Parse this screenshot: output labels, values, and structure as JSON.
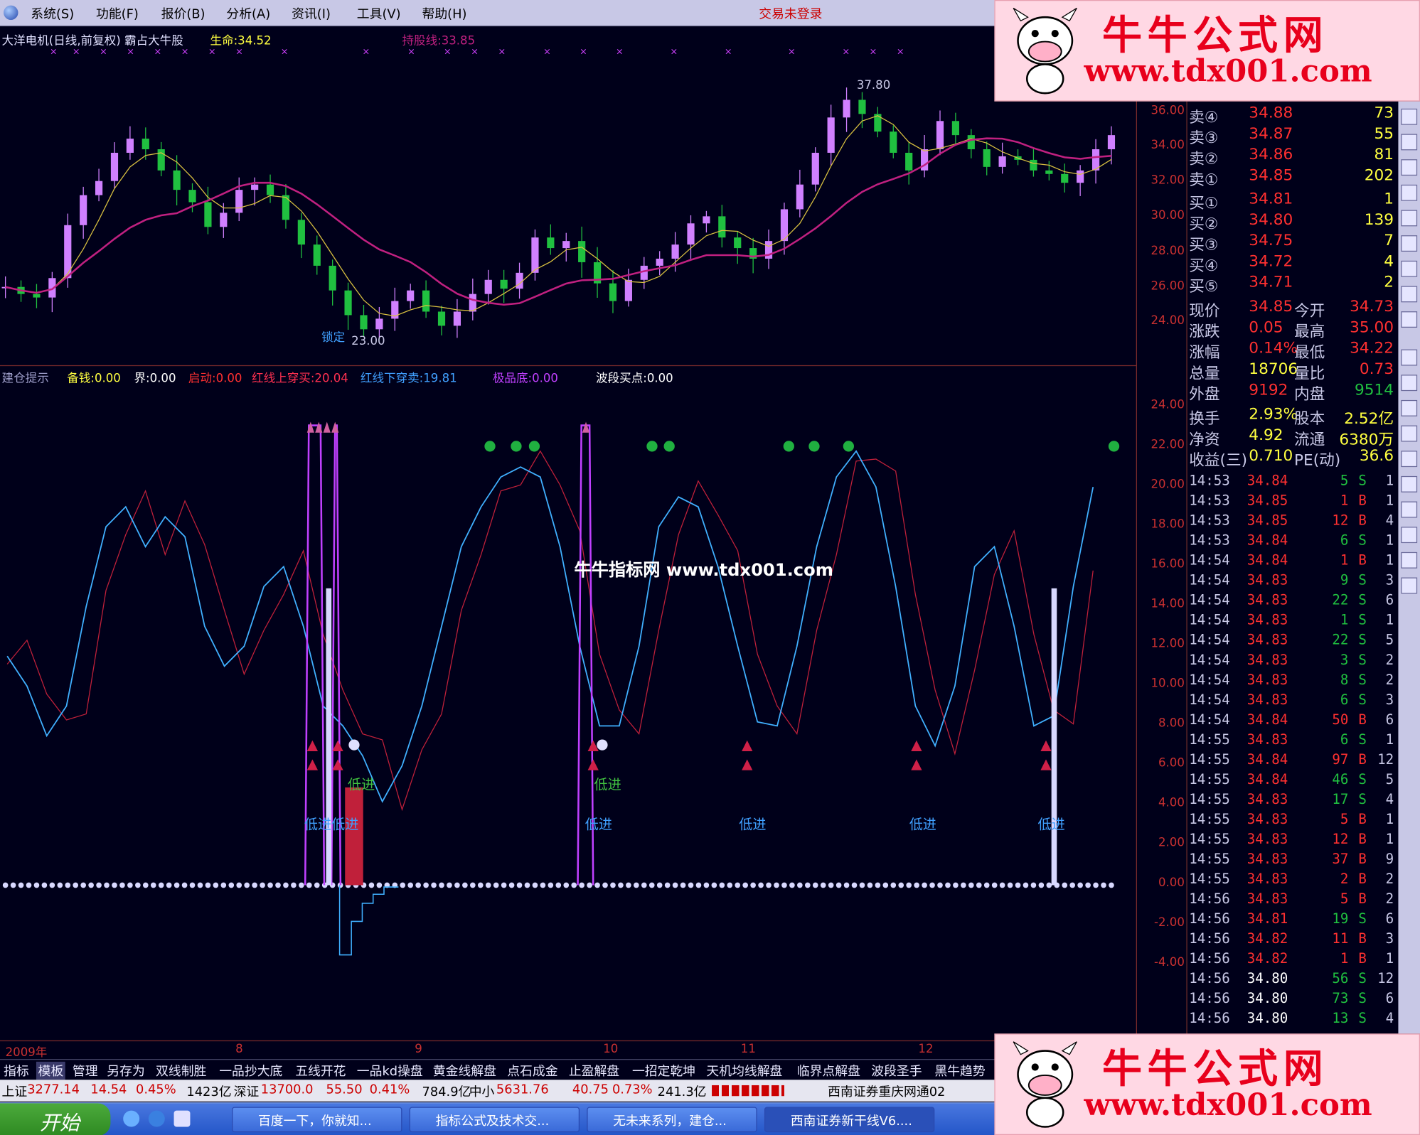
{
  "menu": {
    "items": [
      "系统(S)",
      "功能(F)",
      "报价(B)",
      "分析(A)",
      "资讯(I)",
      "工具(V)",
      "帮助(H)"
    ],
    "status": "交易未登录"
  },
  "ad": {
    "title": "牛牛公式网",
    "url": "www.tdx001.com"
  },
  "watermark": "牛牛指标网 www.tdx001.com",
  "main_chart": {
    "header": "大洋电机(日线,前复权) 霸占大牛股",
    "life_label": "生命:34.52",
    "hold_label": "持股线:33.85",
    "high_label": "37.80",
    "low_label": "23.00",
    "low_marker": "锁定"
  },
  "indicator": {
    "labels": [
      {
        "text": "建仓提示",
        "color": "#9c9cc8"
      },
      {
        "text": "备钱:0.00",
        "color": "#ffff40"
      },
      {
        "text": "界:0.00",
        "color": "#ffffff"
      },
      {
        "text": "启动:0.00",
        "color": "#ff3030"
      },
      {
        "text": "红线上穿买:20.04",
        "color": "#ff3050"
      },
      {
        "text": "红线下穿卖:19.81",
        "color": "#40a0ff"
      },
      {
        "text": "极品底:0.00",
        "color": "#c040ff"
      },
      {
        "text": "波段买点:0.00",
        "color": "#ffffff"
      }
    ],
    "signal_low": "低进",
    "signal_green": "低进"
  },
  "axes": {
    "price_ticks": [
      "36.00",
      "34.00",
      "32.00",
      "30.00",
      "28.00",
      "26.00",
      "24.00"
    ],
    "ind_ticks": [
      "24.00",
      "22.00",
      "20.00",
      "18.00",
      "16.00",
      "14.00",
      "12.00",
      "10.00",
      "8.00",
      "6.00",
      "4.00",
      "2.00",
      "0.00",
      "-2.00",
      "-4.00"
    ],
    "dates": [
      "2009年",
      "8",
      "9",
      "10",
      "11",
      "12"
    ]
  },
  "quotes": {
    "sell": [
      {
        "label": "卖④",
        "price": "34.88",
        "vol": "73"
      },
      {
        "label": "卖③",
        "price": "34.87",
        "vol": "55"
      },
      {
        "label": "卖②",
        "price": "34.86",
        "vol": "81"
      },
      {
        "label": "卖①",
        "price": "34.85",
        "vol": "202"
      }
    ],
    "buy": [
      {
        "label": "买①",
        "price": "34.81",
        "vol": "1"
      },
      {
        "label": "买②",
        "price": "34.80",
        "vol": "139"
      },
      {
        "label": "买③",
        "price": "34.75",
        "vol": "7"
      },
      {
        "label": "买④",
        "price": "34.72",
        "vol": "4"
      },
      {
        "label": "买⑤",
        "price": "34.71",
        "vol": "2"
      }
    ],
    "stats": [
      {
        "k1": "现价",
        "v1": "34.85",
        "k2": "今开",
        "v2": "34.73"
      },
      {
        "k1": "涨跌",
        "v1": "0.05",
        "k2": "最高",
        "v2": "35.00"
      },
      {
        "k1": "涨幅",
        "v1": "0.14%",
        "k2": "最低",
        "v2": "34.22"
      },
      {
        "k1": "总量",
        "v1": "18706",
        "k2": "量比",
        "v2": "0.73"
      },
      {
        "k1": "外盘",
        "v1": "9192",
        "k2": "内盘",
        "v2": "9514"
      }
    ],
    "stats2": [
      {
        "k1": "换手",
        "v1": "2.93%",
        "k2": "股本",
        "v2": "2.52亿"
      },
      {
        "k1": "净资",
        "v1": "4.92",
        "k2": "流通",
        "v2": "6380万"
      },
      {
        "k1": "收益(三)",
        "v1": "0.710",
        "k2": "PE(动)",
        "v2": "36.6"
      }
    ]
  },
  "ticks": [
    [
      "14:53",
      "34.84",
      "5",
      "S",
      "1"
    ],
    [
      "14:53",
      "34.85",
      "1",
      "B",
      "1"
    ],
    [
      "14:53",
      "34.85",
      "12",
      "B",
      "4"
    ],
    [
      "14:53",
      "34.84",
      "6",
      "S",
      "1"
    ],
    [
      "14:54",
      "34.84",
      "1",
      "B",
      "1"
    ],
    [
      "14:54",
      "34.83",
      "9",
      "S",
      "3"
    ],
    [
      "14:54",
      "34.83",
      "22",
      "S",
      "6"
    ],
    [
      "14:54",
      "34.83",
      "1",
      "S",
      "1"
    ],
    [
      "14:54",
      "34.83",
      "22",
      "S",
      "5"
    ],
    [
      "14:54",
      "34.83",
      "3",
      "S",
      "2"
    ],
    [
      "14:54",
      "34.83",
      "8",
      "S",
      "2"
    ],
    [
      "14:54",
      "34.83",
      "6",
      "S",
      "3"
    ],
    [
      "14:54",
      "34.84",
      "50",
      "B",
      "6"
    ],
    [
      "14:55",
      "34.83",
      "6",
      "S",
      "1"
    ],
    [
      "14:55",
      "34.84",
      "97",
      "B",
      "12"
    ],
    [
      "14:55",
      "34.84",
      "46",
      "S",
      "5"
    ],
    [
      "14:55",
      "34.83",
      "17",
      "S",
      "4"
    ],
    [
      "14:55",
      "34.83",
      "5",
      "B",
      "1"
    ],
    [
      "14:55",
      "34.83",
      "12",
      "B",
      "1"
    ],
    [
      "14:55",
      "34.83",
      "37",
      "B",
      "9"
    ],
    [
      "14:55",
      "34.83",
      "2",
      "B",
      "2"
    ],
    [
      "14:56",
      "34.83",
      "5",
      "B",
      "2"
    ],
    [
      "14:56",
      "34.81",
      "19",
      "S",
      "6"
    ],
    [
      "14:56",
      "34.82",
      "11",
      "B",
      "3"
    ],
    [
      "14:56",
      "34.82",
      "1",
      "B",
      "1"
    ],
    [
      "14:56",
      "34.80",
      "56",
      "S",
      "12"
    ],
    [
      "14:56",
      "34.80",
      "73",
      "S",
      "6"
    ],
    [
      "14:56",
      "34.80",
      "13",
      "S",
      "4"
    ]
  ],
  "tabs": [
    "指标",
    "模板",
    "管理",
    "另存为",
    "双线制胜",
    "一品抄大底",
    "五线开花",
    "一品kd操盘",
    "黄金线解盘",
    "点石成金",
    "止盈解盘",
    "一招定乾坤",
    "天机均线解盘",
    "临界点解盘",
    "波段圣手",
    "黑牛趋势"
  ],
  "status": {
    "sh_label": "上证",
    "sh_val": "3277.14",
    "sh_chg": "14.54",
    "sh_pct": "0.45%",
    "sh_amt": "1423亿",
    "sz_label": "深证",
    "sz_val": "13700.0",
    "sz_chg": "55.50",
    "sz_pct": "0.41%",
    "sz_amt": "784.9亿",
    "zx_label": "中小",
    "zx_val": "5631.76",
    "zx_chg": "40.75",
    "zx_pct": "0.73%",
    "zx_amt": "241.3亿",
    "broker": "西南证券重庆网通02"
  },
  "taskbar": {
    "start": "开始",
    "items": [
      "百度一下，你就知...",
      "指标公式及技术交...",
      "无未来系列，建仓...",
      "西南证券新干线V6...."
    ]
  }
}
